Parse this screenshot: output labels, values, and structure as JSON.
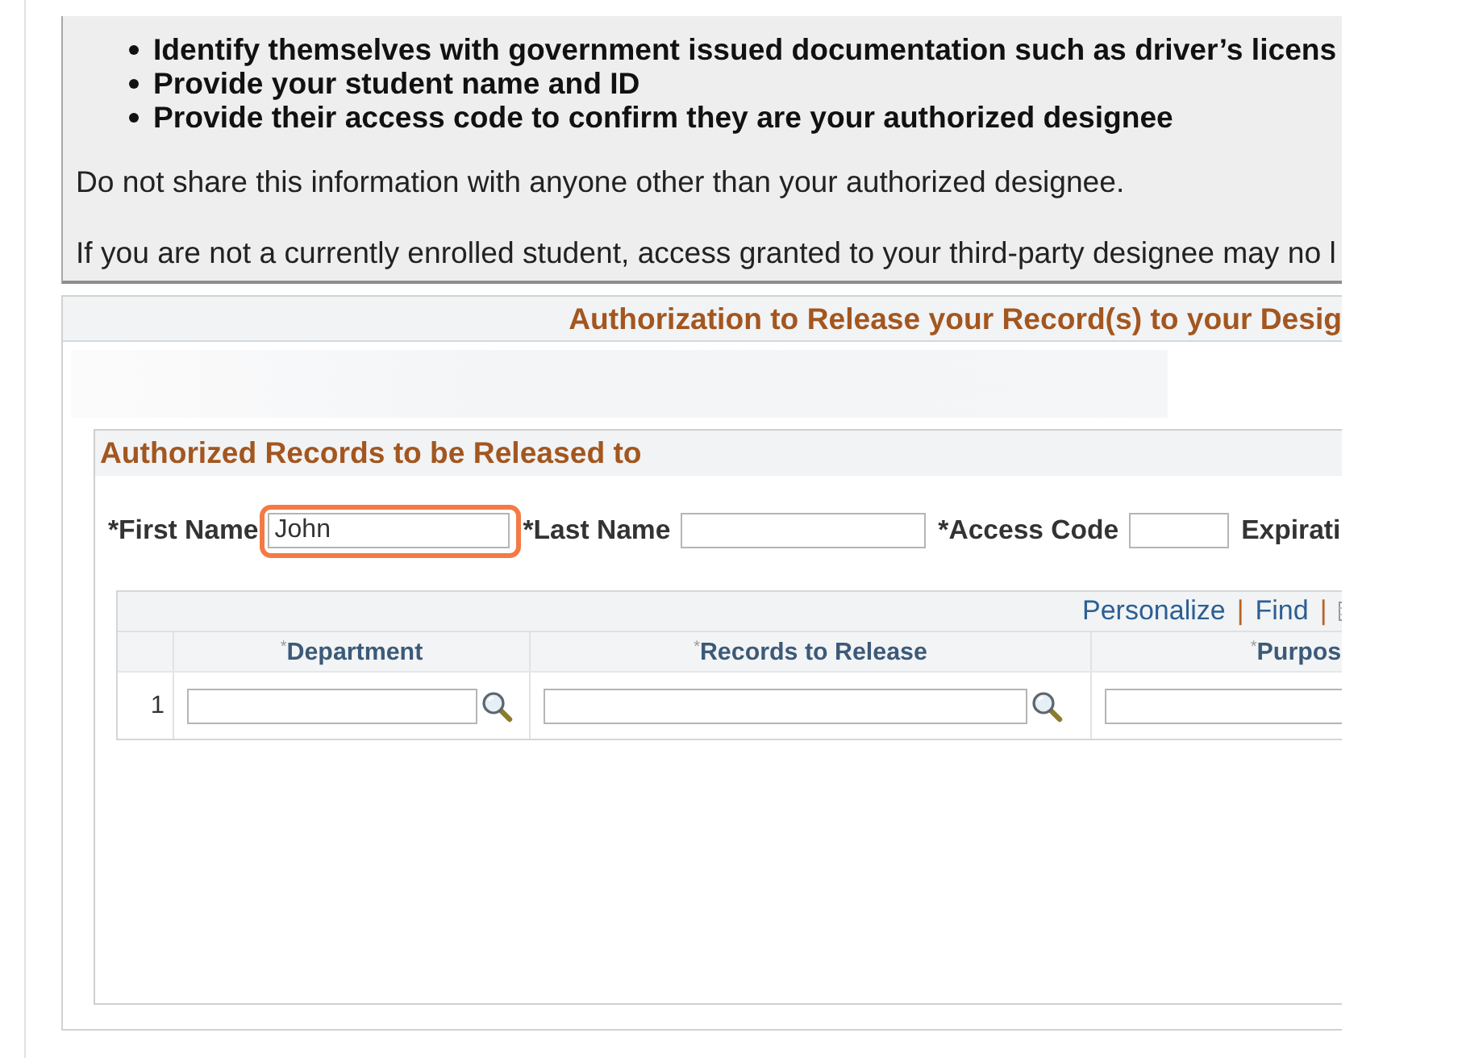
{
  "instructions": {
    "bullets": [
      "Identify themselves with government issued documentation such as driver’s licens",
      "Provide your student name and ID",
      "Provide their access code to confirm they are your authorized designee"
    ],
    "paragraphs": [
      "Do not share this information with anyone other than your authorized designee.",
      "If you are not a currently enrolled student, access granted to your third-party designee may no l"
    ]
  },
  "section": {
    "title": "Authorization to Release your Record(s) to your Desig",
    "group": {
      "title": "Authorized Records to be Released to",
      "fields": [
        {
          "kind": "input",
          "label": "*First Name",
          "value": "John",
          "highlighted": true
        },
        {
          "kind": "input",
          "label": "*Last Name",
          "highlighted": false
        },
        {
          "kind": "input",
          "label": "*Access Code",
          "highlighted": false
        },
        {
          "kind": "label",
          "label": "Expirati"
        }
      ],
      "grid": {
        "toolbar": [
          {
            "kind": "link",
            "text": "Personalize"
          },
          {
            "kind": "separator",
            "text": "|"
          },
          {
            "kind": "link",
            "text": "Find"
          },
          {
            "kind": "separator",
            "text": "|"
          },
          {
            "kind": "icon"
          }
        ],
        "columns": [
          "$^{*}$Department",
          "$^{*}$Records to Release",
          "$^{*}$Purpos"
        ],
        "rows": [
          {
            "number": "1",
            "cells": [
              {
                "kind": "lookup"
              },
              {
                "kind": "lookup"
              },
              {
                "kind": "text"
              }
            ]
          }
        ]
      }
    }
  }
}
